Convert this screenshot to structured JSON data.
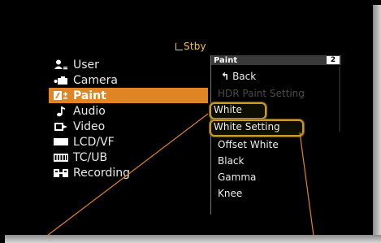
{
  "status": {
    "icon": "standby-icon",
    "text": "Stby"
  },
  "left_menu": {
    "items": [
      {
        "label": "User",
        "icon": "user-icon",
        "active": false
      },
      {
        "label": "Camera",
        "icon": "camera-icon",
        "active": false
      },
      {
        "label": "Paint",
        "icon": "paint-icon",
        "active": true
      },
      {
        "label": "Audio",
        "icon": "music-note-icon",
        "active": false
      },
      {
        "label": "Video",
        "icon": "video-output-icon",
        "active": false
      },
      {
        "label": "LCD/VF",
        "icon": "lcd-icon",
        "active": false
      },
      {
        "label": "TC/UB",
        "icon": "timecode-icon",
        "active": false
      },
      {
        "label": "Recording",
        "icon": "film-reel-icon",
        "active": false
      }
    ]
  },
  "right_panel": {
    "title": "Paint",
    "page": "2",
    "items": [
      {
        "label": "Back",
        "icon": "back-arrow-icon",
        "disabled": false,
        "highlighted": false
      },
      {
        "label": "HDR Paint Setting",
        "disabled": true,
        "highlighted": false
      },
      {
        "label": "White",
        "disabled": false,
        "highlighted": true
      },
      {
        "label": "White Setting",
        "disabled": false,
        "highlighted": true
      },
      {
        "label": "Offset White",
        "disabled": false,
        "highlighted": false
      },
      {
        "label": "Black",
        "disabled": false,
        "highlighted": false
      },
      {
        "label": "Gamma",
        "disabled": false,
        "highlighted": false
      },
      {
        "label": "Knee",
        "disabled": false,
        "highlighted": false
      }
    ]
  },
  "colors": {
    "accent": "#e08524",
    "callout": "#e08524",
    "highlight_border": "#c89a2a"
  }
}
